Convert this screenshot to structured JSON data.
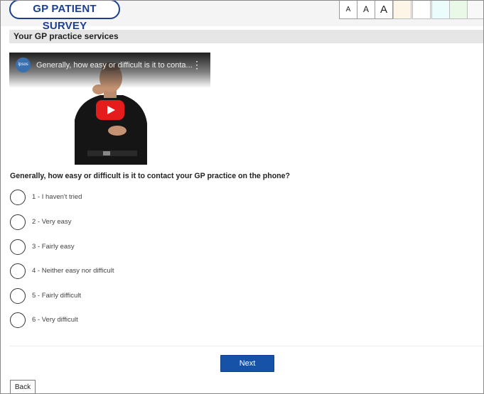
{
  "header": {
    "logo_text": "GP PATIENT SURVEY",
    "font_size_buttons": [
      "A",
      "A",
      "A"
    ],
    "colour_swatches": [
      "#f2f2f2",
      "#fdf6e6",
      "#ffffff",
      "#eafcfc",
      "#eaf8e8",
      "#f8f8f8"
    ]
  },
  "section": {
    "title": "Your GP practice services"
  },
  "video": {
    "channel_label": "Ipsos",
    "title": "Generally, how easy or difficult is it to conta...",
    "menu_icon": "kebab-menu-icon",
    "play_icon": "youtube-play-icon"
  },
  "question": {
    "text": "Generally, how easy or difficult is it to contact your GP practice on the phone?",
    "options": [
      "1 - I haven't tried",
      "2 - Very easy",
      "3 - Fairly easy",
      "4 - Neither easy nor difficult",
      "5 - Fairly difficult",
      "6 - Very difficult"
    ]
  },
  "buttons": {
    "next": "Next",
    "back": "Back"
  },
  "colors": {
    "brand_blue": "#1c3f94",
    "next_blue": "#1652a8",
    "play_red": "#e51c1c"
  }
}
